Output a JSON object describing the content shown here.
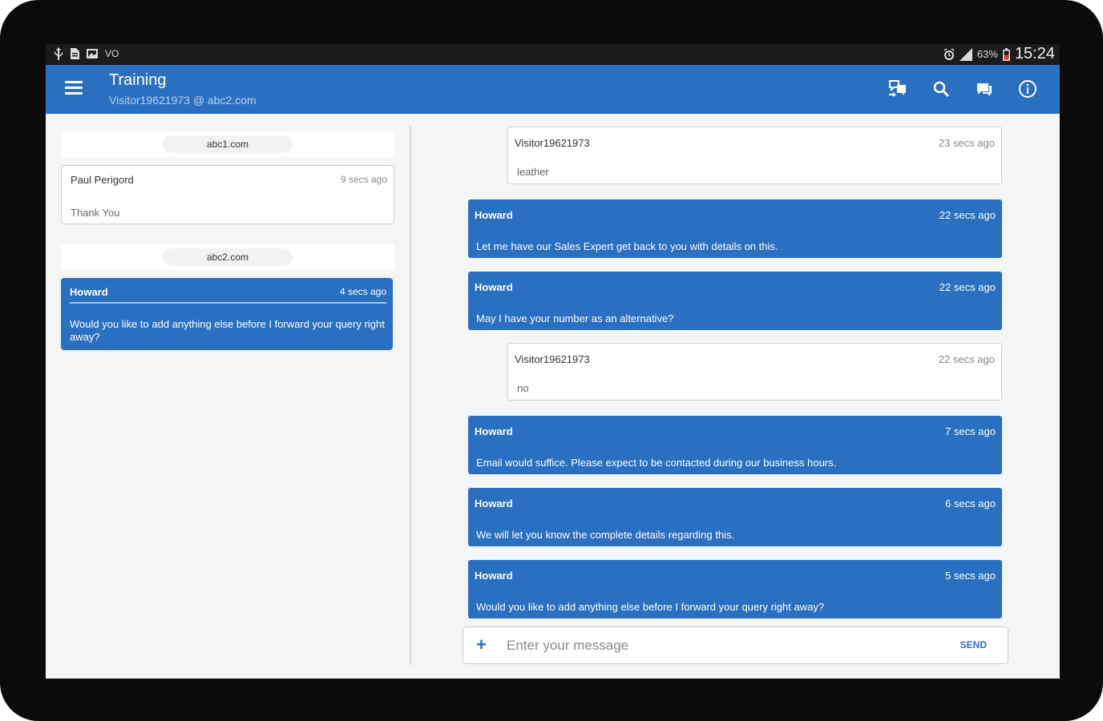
{
  "statusbar": {
    "left_icons": [
      "usb-icon",
      "document-icon",
      "image-icon",
      "voicemail-icon"
    ],
    "left_text": "VO",
    "battery_pct": "63%",
    "time": "15:24"
  },
  "appbar": {
    "title": "Training",
    "subtitle": "Visitor19621973 @ abc2.com",
    "actions": [
      "transfer-chat-icon",
      "search-icon",
      "chat-bubble-icon",
      "info-icon"
    ]
  },
  "sidebar": {
    "groups": [
      {
        "domain": "abc1.com",
        "conversation": {
          "name": "Paul Perigord",
          "time": "9 secs ago",
          "message": "Thank You"
        }
      },
      {
        "domain": "abc2.com",
        "conversation": {
          "name": "Howard",
          "time": "4 secs ago",
          "message": "Would you like to add anything else before I forward your query right away?"
        }
      }
    ]
  },
  "chat": {
    "messages": [
      {
        "sender": "Visitor19621973",
        "time": "23 secs ago",
        "text": "leather",
        "type": "visitor"
      },
      {
        "sender": "Howard",
        "time": "22 secs ago",
        "text": "Let me have our Sales Expert get back to you with details on this.",
        "type": "agent"
      },
      {
        "sender": "Howard",
        "time": "22 secs ago",
        "text": "May I have your number as an alternative?",
        "type": "agent"
      },
      {
        "sender": "Visitor19621973",
        "time": "22 secs ago",
        "text": "no",
        "type": "visitor"
      },
      {
        "sender": "Howard",
        "time": "7 secs ago",
        "text": "Email would suffice. Please expect to be contacted during our business hours.",
        "type": "agent"
      },
      {
        "sender": "Howard",
        "time": "6 secs ago",
        "text": "We will let you know the complete details regarding this.",
        "type": "agent"
      },
      {
        "sender": "Howard",
        "time": "5 secs ago",
        "text": "Would you like to add anything else before I forward your query right away?",
        "type": "agent"
      }
    ],
    "composer": {
      "placeholder": "Enter your message",
      "send_label": "SEND",
      "plus": "+"
    }
  },
  "colors": {
    "accent": "#2a6fc0",
    "statusbar": "#1b1b1b",
    "background": "#f4f5f6"
  }
}
